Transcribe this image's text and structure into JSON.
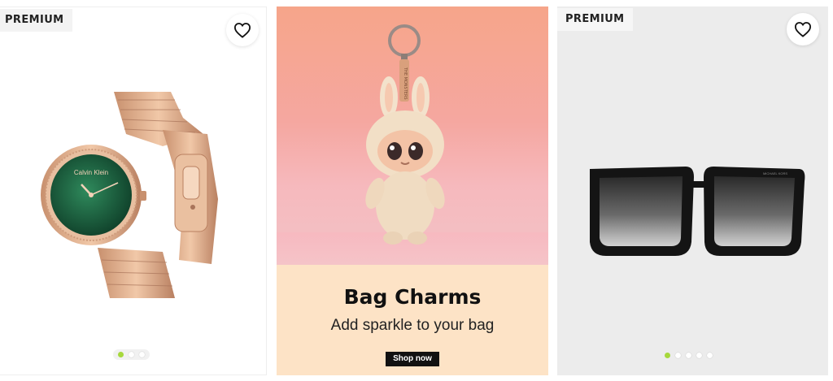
{
  "products": [
    {
      "badge": "PREMIUM",
      "image_alt": "Rose gold Calvin Klein watch with green dial",
      "dial_brand": "Calvin Klein",
      "carousel": {
        "count": 3,
        "active": 0
      }
    },
    {
      "badge": "PREMIUM",
      "image_alt": "Black oversized square sunglasses",
      "frame_brand": "MICHAEL KORS",
      "carousel": {
        "count": 5,
        "active": 0
      }
    }
  ],
  "promo": {
    "title": "Bag Charms",
    "subtitle": "Add sparkle to your bag",
    "cta": "Shop now",
    "charm_tag": "THE MONSTERS"
  },
  "colors": {
    "accent_dot": "#a6d83c",
    "promo_panel": "#fde3c6",
    "cta_bg": "#111111"
  },
  "icons": {
    "wishlist": "heart-outline-icon"
  }
}
